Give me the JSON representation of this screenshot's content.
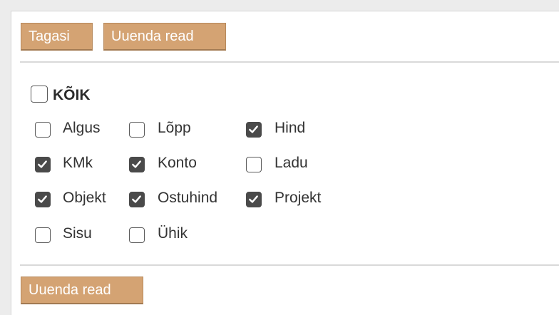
{
  "toolbar": {
    "back_label": "Tagasi",
    "update_label": "Uuenda read"
  },
  "select_all": {
    "label": "KÕIK",
    "checked": false
  },
  "columns": [
    {
      "label": "Algus",
      "checked": false
    },
    {
      "label": "Lõpp",
      "checked": false
    },
    {
      "label": "Hind",
      "checked": true
    },
    {
      "label": "KMk",
      "checked": true
    },
    {
      "label": "Konto",
      "checked": true
    },
    {
      "label": "Ladu",
      "checked": false
    },
    {
      "label": "Objekt",
      "checked": true
    },
    {
      "label": "Ostuhind",
      "checked": true
    },
    {
      "label": "Projekt",
      "checked": true
    },
    {
      "label": "Sisu",
      "checked": false
    },
    {
      "label": "Ühik",
      "checked": false
    }
  ],
  "footer": {
    "update_label": "Uuenda read"
  },
  "colors": {
    "button_bg": "#d4a373",
    "checkbox_checked": "#4a4a4a",
    "panel_bg": "#ffffff",
    "page_bg": "#ececec"
  }
}
